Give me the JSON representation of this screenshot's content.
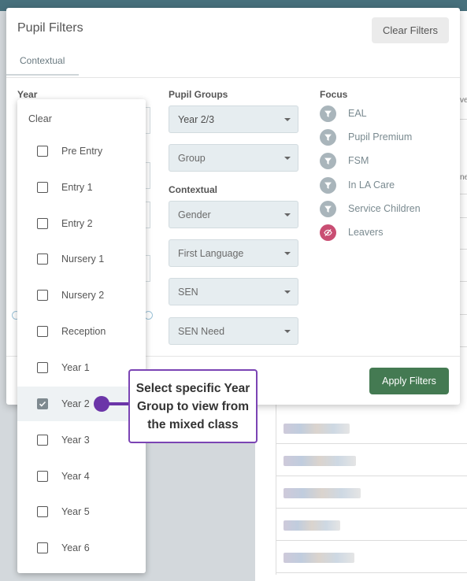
{
  "modal": {
    "title": "Pupil Filters",
    "clear_filters_label": "Clear Filters",
    "tab_label": "Contextual",
    "apply_filters_label": "Apply Filters"
  },
  "year": {
    "label": "Year"
  },
  "pupil_groups": {
    "label": "Pupil Groups",
    "year_group_value": "Year 2/3",
    "group_placeholder": "Group"
  },
  "contextual": {
    "label": "Contextual",
    "selects": [
      "Gender",
      "First Language",
      "SEN",
      "SEN Need"
    ]
  },
  "focus": {
    "label": "Focus",
    "items": [
      {
        "label": "EAL",
        "icon": "filter-icon"
      },
      {
        "label": "Pupil Premium",
        "icon": "filter-icon"
      },
      {
        "label": "FSM",
        "icon": "filter-icon"
      },
      {
        "label": "In LA Care",
        "icon": "filter-icon"
      },
      {
        "label": "Service Children",
        "icon": "filter-icon"
      },
      {
        "label": "Leavers",
        "icon": "eye-off-icon"
      }
    ]
  },
  "year_dropdown": {
    "clear_label": "Clear",
    "options": [
      {
        "label": "Pre Entry",
        "checked": false
      },
      {
        "label": "Entry 1",
        "checked": false
      },
      {
        "label": "Entry 2",
        "checked": false
      },
      {
        "label": "Nursery 1",
        "checked": false
      },
      {
        "label": "Nursery 2",
        "checked": false
      },
      {
        "label": "Reception",
        "checked": false
      },
      {
        "label": "Year 1",
        "checked": false
      },
      {
        "label": "Year 2",
        "checked": true
      },
      {
        "label": "Year 3",
        "checked": false
      },
      {
        "label": "Year 4",
        "checked": false
      },
      {
        "label": "Year 5",
        "checked": false
      },
      {
        "label": "Year 6",
        "checked": false
      }
    ]
  },
  "callout": {
    "text": "Select specific Year Group to view from the mixed class"
  },
  "background": {
    "edge_text_1": "ve",
    "edge_text_2": "ne"
  },
  "colors": {
    "apply_button": "#447a52",
    "callout_accent": "#6b35a8",
    "leavers_icon": "#c94e73",
    "focus_icon": "#a9b5bb"
  }
}
